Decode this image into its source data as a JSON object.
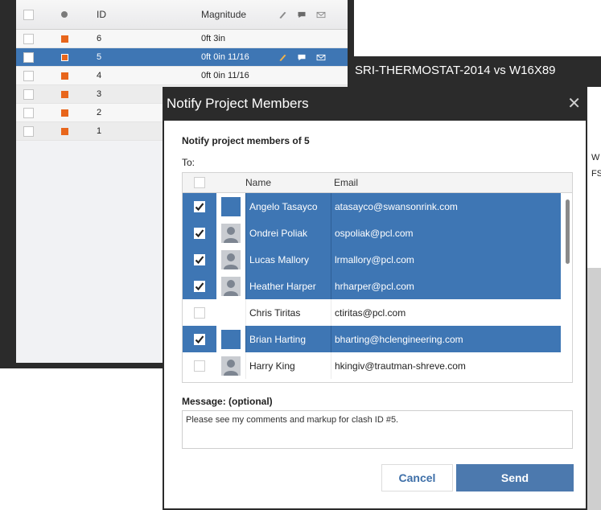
{
  "clash_table": {
    "headers": {
      "id": "ID",
      "magnitude": "Magnitude"
    },
    "rows": [
      {
        "id": "6",
        "magnitude": "0ft 3in",
        "selected": false
      },
      {
        "id": "5",
        "magnitude": "0ft 0in 11/16",
        "selected": true
      },
      {
        "id": "4",
        "magnitude": "0ft 0in 11/16",
        "selected": false
      },
      {
        "id": "3",
        "magnitude": "",
        "selected": false
      },
      {
        "id": "2",
        "magnitude": "",
        "selected": false
      },
      {
        "id": "1",
        "magnitude": "",
        "selected": false
      }
    ]
  },
  "window": {
    "title": "SRI-THERMOSTAT-2014 vs W16X89"
  },
  "right_panel": {
    "line1": "W",
    "line2": "FS"
  },
  "dialog": {
    "title": "Notify Project Members",
    "heading": "Notify project members of 5",
    "to_label": "To:",
    "columns": {
      "name": "Name",
      "email": "Email"
    },
    "members": [
      {
        "name": "Angelo Tasayco",
        "email": "atasayco@swansonrink.com",
        "checked": true,
        "avatar": "blue-square"
      },
      {
        "name": "Ondrei Poliak",
        "email": "ospoliak@pcl.com",
        "checked": true,
        "avatar": "person-icon"
      },
      {
        "name": "Lucas Mallory",
        "email": "lrmallory@pcl.com",
        "checked": true,
        "avatar": "person-icon"
      },
      {
        "name": "Heather Harper",
        "email": "hrharper@pcl.com",
        "checked": true,
        "avatar": "person-icon"
      },
      {
        "name": "Chris Tiritas",
        "email": "ctiritas@pcl.com",
        "checked": false,
        "avatar": "none"
      },
      {
        "name": "Brian Harting",
        "email": "bharting@hclengineering.com",
        "checked": true,
        "avatar": "blue-square"
      },
      {
        "name": "Harry King",
        "email": "hkingiv@trautman-shreve.com",
        "checked": false,
        "avatar": "person-icon"
      }
    ],
    "message_label": "Message: (optional)",
    "message_value": "Please see my comments and markup for clash ID #5.",
    "cancel_label": "Cancel",
    "send_label": "Send"
  },
  "colors": {
    "selection": "#3e76b4",
    "title_bar": "#2b2b2b",
    "status": "#e8661c",
    "send": "#4c79ae"
  }
}
